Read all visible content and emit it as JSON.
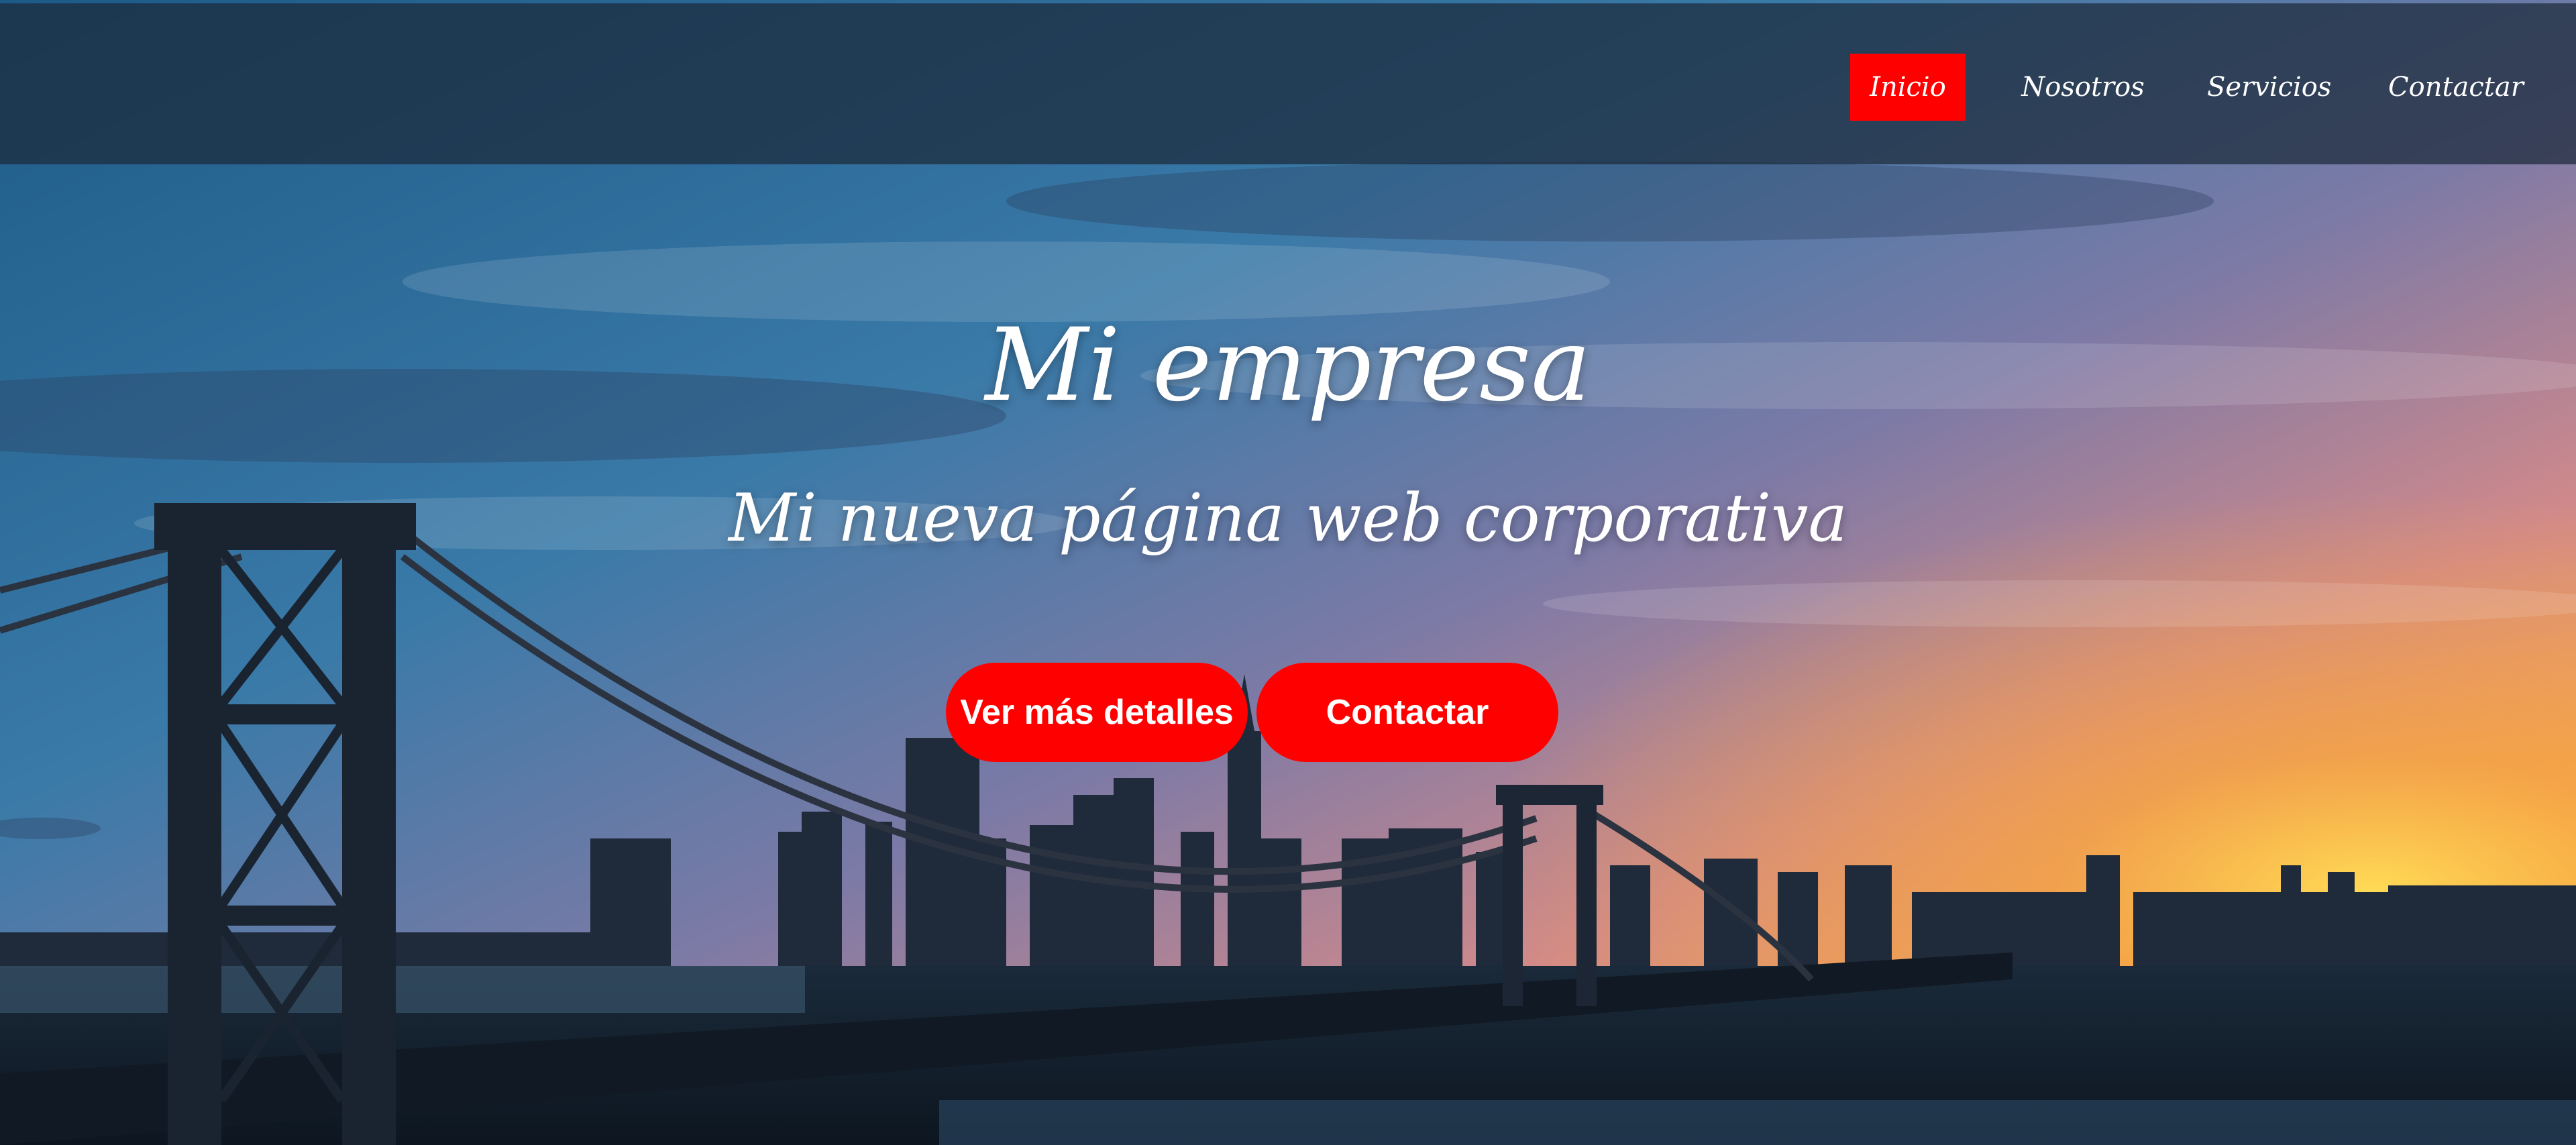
{
  "nav": {
    "items": [
      {
        "label": "Inicio",
        "active": true
      },
      {
        "label": "Nosotros",
        "active": false
      },
      {
        "label": "Servicios",
        "active": false
      },
      {
        "label": "Contactar",
        "active": false
      }
    ]
  },
  "hero": {
    "title": "Mi empresa",
    "subtitle": "Mi nueva página web corporativa",
    "buttons": {
      "details_label": "Ver más detalles",
      "contact_label": "Contactar"
    }
  },
  "colors": {
    "accent": "#ff0000",
    "nav_background": "#1c2a3a",
    "text": "#ffffff"
  }
}
